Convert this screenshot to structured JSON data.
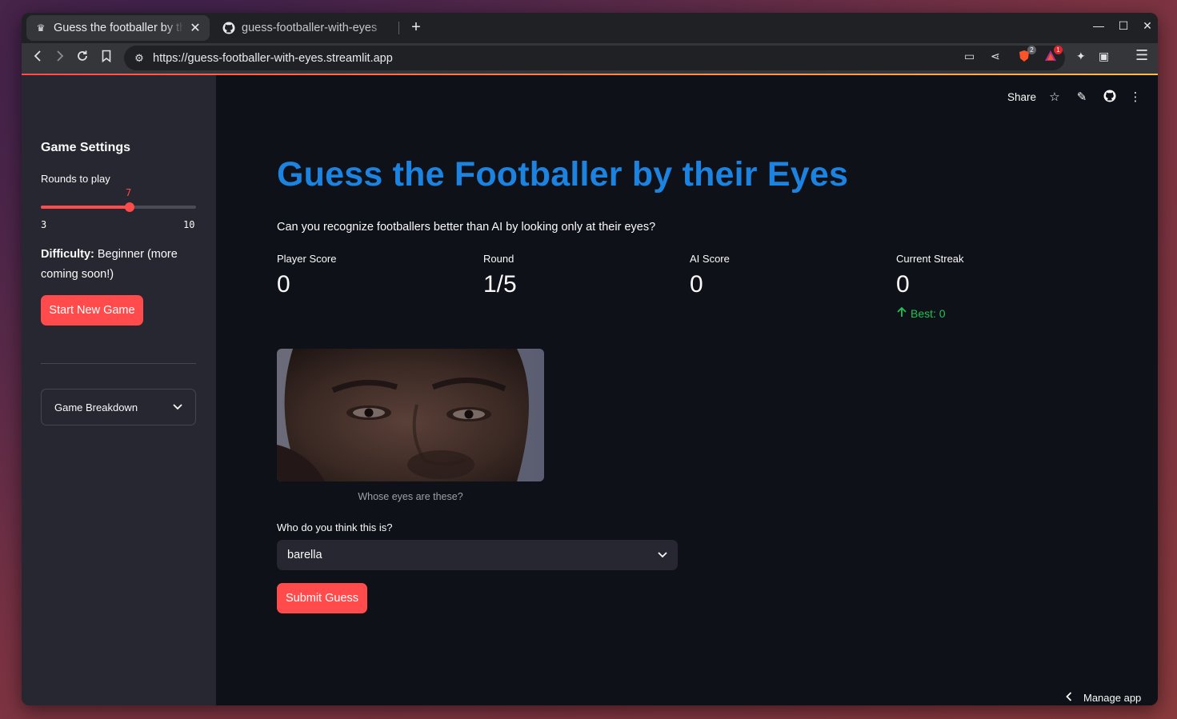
{
  "browser": {
    "tabs": [
      {
        "title": "Guess the footballer by their Eyes",
        "active": true
      },
      {
        "title": "guess-footballer-with-eyes",
        "active": false
      }
    ],
    "new_tab_label": "+",
    "url": "https://guess-footballer-with-eyes.streamlit.app",
    "badges": {
      "brave_shields": "2",
      "rewards": "1"
    }
  },
  "header": {
    "share_label": "Share"
  },
  "sidebar": {
    "title": "Game Settings",
    "rounds_label": "Rounds to play",
    "slider": {
      "value": "7",
      "min": "3",
      "max": "10",
      "fraction": 0.571
    },
    "difficulty_key": "Difficulty:",
    "difficulty_value": "Beginner (more coming soon!)",
    "start_button": "Start New Game",
    "expander_label": "Game Breakdown"
  },
  "main": {
    "title": "Guess the Footballer by their Eyes",
    "subtitle": "Can you recognize footballers better than AI by looking only at their eyes?",
    "metrics": [
      {
        "label": "Player Score",
        "value": "0"
      },
      {
        "label": "Round",
        "value": "1/5"
      },
      {
        "label": "AI Score",
        "value": "0"
      },
      {
        "label": "Current Streak",
        "value": "0",
        "delta": "Best: 0"
      }
    ],
    "image_caption": "Whose eyes are these?",
    "select_label": "Who do you think this is?",
    "select_value": "barella",
    "submit_button": "Submit Guess",
    "manage_app": "Manage app"
  },
  "colors": {
    "accent_red": "#ff4b4b",
    "title_blue": "#1c83e1",
    "delta_green": "#21c354",
    "bg": "#0e1117",
    "sidebar_bg": "#262730"
  }
}
